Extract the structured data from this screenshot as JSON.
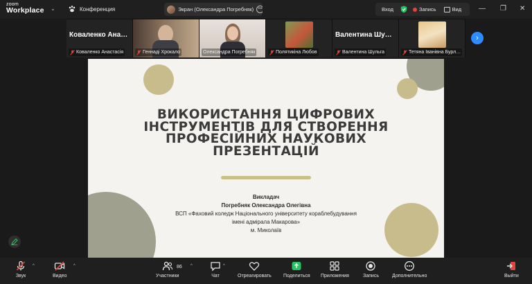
{
  "app": {
    "brand_small": "zoom",
    "brand_large": "Workplace",
    "meeting_label": "Конференция"
  },
  "share_banner": {
    "label": "Экран (Олександра Погребняк)"
  },
  "top_controls": {
    "enter": "Вход",
    "record": "Запись",
    "view": "Вид"
  },
  "participants": [
    {
      "big_name": "Коваленко  Ана…",
      "label": "Коваленко Анастасія",
      "muted": true,
      "has_video": false
    },
    {
      "big_name": "",
      "label": "Геннаді Хрокало",
      "muted": true,
      "has_video": true
    },
    {
      "big_name": "",
      "label": "Олександра Погребняк",
      "muted": false,
      "has_video": true,
      "active": true
    },
    {
      "big_name": "",
      "label": "Полятикіна Любов",
      "muted": true,
      "has_video": true
    },
    {
      "big_name": "Валентина  Шу…",
      "label": "Валентина Шульга",
      "muted": true,
      "has_video": false
    },
    {
      "big_name": "",
      "label": "Тетяна Іванівна Бурл…",
      "muted": true,
      "has_video": true
    }
  ],
  "slide": {
    "title_lines": [
      "ВИКОРИСТАННЯ ЦИФРОВИХ",
      "ІНСТРУМЕНТІВ ДЛЯ СТВОРЕННЯ",
      "ПРОФЕСІЙНИХ НАУКОВИХ",
      "ПРЕЗЕНТАЦІЙ"
    ],
    "role": "Викладач",
    "author": "Погребняк Олександра Олегівна",
    "institution_line1": "ВСП «Фаховий коледж  Національного університету кораблебудування",
    "institution_line2": "імені адмірала Макарова»",
    "city": "м. Миколаїв",
    "colors": {
      "olive": "#9fa08d",
      "sand": "#c8bc8c",
      "background": "#f4f3f0"
    }
  },
  "toolbar": {
    "audio": "Звук",
    "video": "Видео",
    "participants": "Участники",
    "participants_count": "86",
    "chat": "Чат",
    "react": "Отреагировать",
    "share": "Поделиться",
    "apps": "Приложения",
    "record": "Запись",
    "more": "Дополнительно",
    "leave": "Выйти"
  },
  "icons": {
    "meeting": "paw-icon",
    "mic": "mic-off-icon",
    "video": "video-off-icon",
    "share": "share-arrow-icon",
    "leave": "leave-icon"
  },
  "accent_colors": {
    "active_speaker": "#23c55e",
    "share": "#23c55e",
    "record": "#e0463b",
    "next": "#2d8cff"
  }
}
